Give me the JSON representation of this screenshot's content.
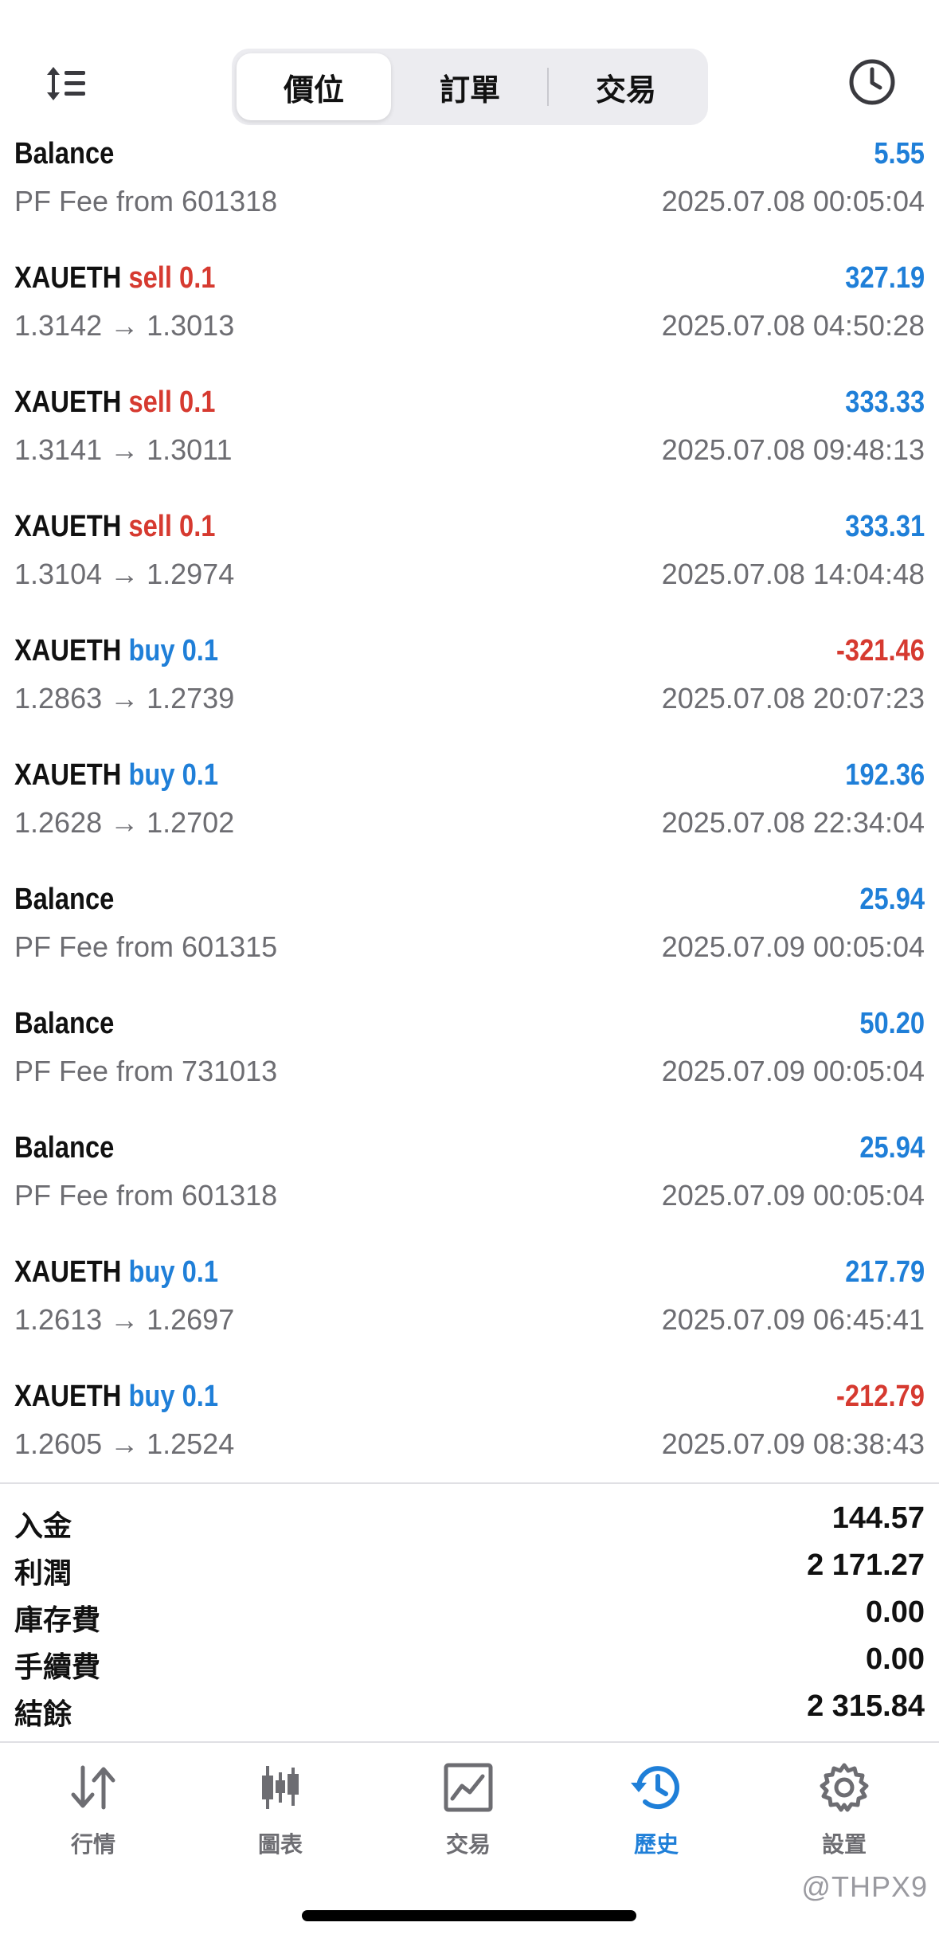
{
  "header": {
    "tabs": [
      {
        "label": "價位",
        "active": true
      },
      {
        "label": "訂單",
        "active": false
      },
      {
        "label": "交易",
        "active": false
      }
    ],
    "sort_icon": "sort-arrows-icon",
    "history_icon": "clock-icon"
  },
  "deals": [
    {
      "symbol": "Balance",
      "type": "",
      "volume": "",
      "amount": "5.55",
      "sign": "pos",
      "sub": "PF Fee from 601318",
      "time": "2025.07.08 00:05:04"
    },
    {
      "symbol": "XAUETH",
      "type": "sell",
      "volume": "0.1",
      "amount": "327.19",
      "sign": "pos",
      "sub": "1.3142 → 1.3013",
      "time": "2025.07.08 04:50:28"
    },
    {
      "symbol": "XAUETH",
      "type": "sell",
      "volume": "0.1",
      "amount": "333.33",
      "sign": "pos",
      "sub": "1.3141 → 1.3011",
      "time": "2025.07.08 09:48:13"
    },
    {
      "symbol": "XAUETH",
      "type": "sell",
      "volume": "0.1",
      "amount": "333.31",
      "sign": "pos",
      "sub": "1.3104 → 1.2974",
      "time": "2025.07.08 14:04:48"
    },
    {
      "symbol": "XAUETH",
      "type": "buy",
      "volume": "0.1",
      "amount": "-321.46",
      "sign": "neg",
      "sub": "1.2863 → 1.2739",
      "time": "2025.07.08 20:07:23"
    },
    {
      "symbol": "XAUETH",
      "type": "buy",
      "volume": "0.1",
      "amount": "192.36",
      "sign": "pos",
      "sub": "1.2628 → 1.2702",
      "time": "2025.07.08 22:34:04"
    },
    {
      "symbol": "Balance",
      "type": "",
      "volume": "",
      "amount": "25.94",
      "sign": "pos",
      "sub": "PF Fee from 601315",
      "time": "2025.07.09 00:05:04"
    },
    {
      "symbol": "Balance",
      "type": "",
      "volume": "",
      "amount": "50.20",
      "sign": "pos",
      "sub": "PF Fee from 731013",
      "time": "2025.07.09 00:05:04"
    },
    {
      "symbol": "Balance",
      "type": "",
      "volume": "",
      "amount": "25.94",
      "sign": "pos",
      "sub": "PF Fee from 601318",
      "time": "2025.07.09 00:05:04"
    },
    {
      "symbol": "XAUETH",
      "type": "buy",
      "volume": "0.1",
      "amount": "217.79",
      "sign": "pos",
      "sub": "1.2613 → 1.2697",
      "time": "2025.07.09 06:45:41"
    },
    {
      "symbol": "XAUETH",
      "type": "buy",
      "volume": "0.1",
      "amount": "-212.79",
      "sign": "neg",
      "sub": "1.2605 → 1.2524",
      "time": "2025.07.09 08:38:43"
    }
  ],
  "summary": [
    {
      "label": "入金",
      "value": "144.57"
    },
    {
      "label": "利潤",
      "value": "2 171.27"
    },
    {
      "label": "庫存費",
      "value": "0.00"
    },
    {
      "label": "手續費",
      "value": "0.00"
    },
    {
      "label": "結餘",
      "value": "2 315.84"
    }
  ],
  "tabbar": [
    {
      "label": "行情",
      "icon": "quotes-arrows-icon",
      "active": false
    },
    {
      "label": "圖表",
      "icon": "candlestick-chart-icon",
      "active": false
    },
    {
      "label": "交易",
      "icon": "trade-chart-icon",
      "active": false
    },
    {
      "label": "歷史",
      "icon": "history-icon",
      "active": true
    },
    {
      "label": "設置",
      "icon": "gear-icon",
      "active": false
    }
  ],
  "watermark": "@THPX9",
  "colors": {
    "accent": "#1f7fd8",
    "negative": "#d63a30",
    "muted": "#6d6d72"
  }
}
